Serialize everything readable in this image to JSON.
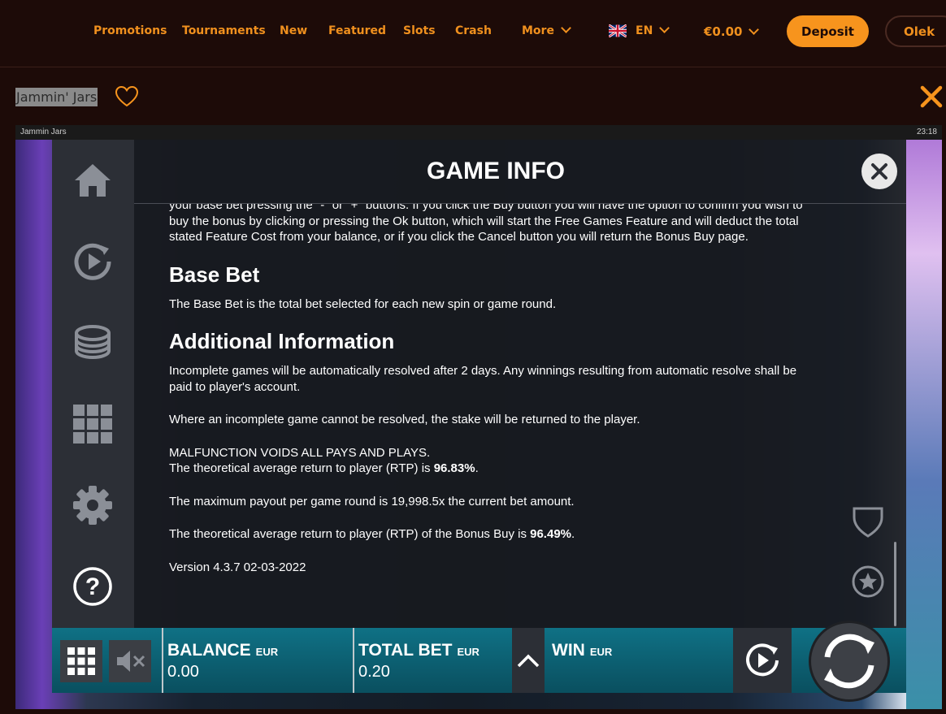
{
  "nav": {
    "links": [
      "Promotions",
      "Tournaments",
      "New",
      "Featured",
      "Slots",
      "Crash"
    ],
    "more_label": "More",
    "language": "EN",
    "balance": "€0.00",
    "deposit_label": "Deposit",
    "user_name": "Olek"
  },
  "game": {
    "title": "Jammin' Jars",
    "frame_title": "Jammin Jars",
    "clock": "23:18"
  },
  "info": {
    "title": "GAME INFO",
    "intro_paragraph": "your base bet pressing the \"-\" or \"+\" buttons. If you click the Buy button you will have the option to confirm you wish to buy the bonus by clicking or pressing the Ok button, which will start the Free Games Feature and will deduct the total stated Feature Cost from your balance, or if you click the Cancel button you will return the Bonus Buy page.",
    "base_bet_heading": "Base Bet",
    "base_bet_text": "The Base Bet is the total bet selected for each new spin or game round.",
    "additional_heading": "Additional Information",
    "incomplete_text": "Incomplete games will be automatically resolved after 2 days. Any winnings resulting from automatic resolve shall be paid to player's account.",
    "unresolved_text": "Where an incomplete game cannot be resolved, the stake will be returned to the player.",
    "malfunction_text": "MALFUNCTION VOIDS ALL PAYS AND PLAYS.",
    "rtp_prefix": "The theoretical average return to player (RTP) is ",
    "rtp_value": "96.83%",
    "rtp_suffix": ".",
    "max_payout_text": "The maximum payout per game round is 19,998.5x the current bet amount.",
    "bonus_rtp_prefix": "The theoretical average return to player (RTP) of the Bonus Buy is ",
    "bonus_rtp_value": "96.49%",
    "bonus_rtp_suffix": ".",
    "version_text": "Version 4.3.7 02-03-2022"
  },
  "bottom": {
    "balance_label": "BALANCE",
    "balance_currency": "EUR",
    "balance_value": "0.00",
    "total_bet_label": "TOTAL BET",
    "total_bet_currency": "EUR",
    "total_bet_value": "0.20",
    "win_label": "WIN",
    "win_currency": "EUR"
  },
  "colors": {
    "accent": "#f7941d",
    "nav_bg": "#1d0b08",
    "bottom_bar": "#0f7185"
  },
  "icons": [
    "home-icon",
    "replay-icon",
    "coins-icon",
    "grid-icon",
    "gear-icon",
    "help-icon",
    "shield-icon",
    "star-icon",
    "mute-icon",
    "chevron-up-icon",
    "autoplay-icon",
    "spin-icon",
    "heart-icon",
    "close-icon",
    "uk-flag-icon"
  ]
}
